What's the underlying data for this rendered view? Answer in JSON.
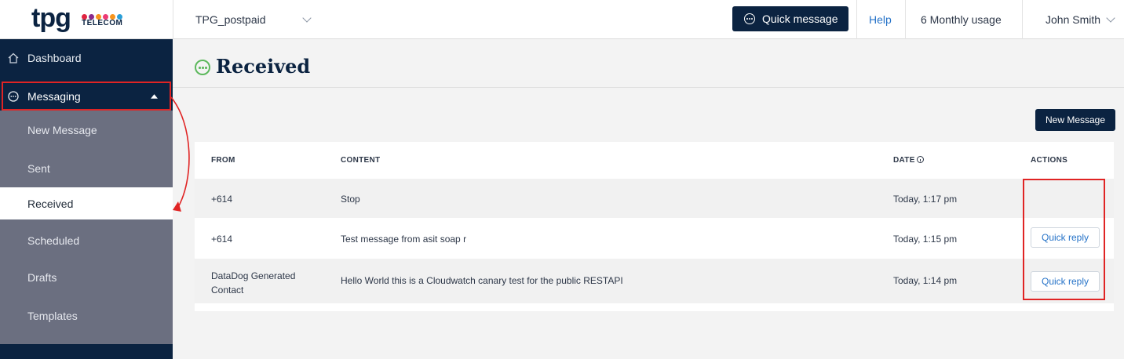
{
  "brand": {
    "logo_text": "tpg",
    "logo_subtext": "TELECOM",
    "dot_colors": [
      "#e02440",
      "#8b2a8c",
      "#f7941d",
      "#ee3a74",
      "#f7941d",
      "#2a9fd8"
    ]
  },
  "topbar": {
    "account": "TPG_postpaid",
    "quick_message": "Quick message",
    "help": "Help",
    "usage": "6 Monthly usage",
    "user": "John Smith"
  },
  "sidebar": {
    "dashboard": "Dashboard",
    "messaging": "Messaging",
    "submenu": [
      "New Message",
      "Sent",
      "Received",
      "Scheduled",
      "Drafts",
      "Templates"
    ]
  },
  "page": {
    "title": "Received",
    "new_message_button": "New Message"
  },
  "table": {
    "headers": {
      "from": "FROM",
      "content": "CONTENT",
      "date": "DATE",
      "actions": "ACTIONS"
    },
    "rows": [
      {
        "from": "+614",
        "content": "Stop",
        "date": "Today, 1:17 pm",
        "action": ""
      },
      {
        "from": "+614",
        "content": "Test message from asit soap r",
        "date": "Today, 1:15 pm",
        "action": "Quick reply"
      },
      {
        "from": "DataDog Generated Contact",
        "from_line1": "DataDog Generated",
        "from_line2": "Contact",
        "content": "Hello World this is a Cloudwatch canary test for the public RESTAPI",
        "date": "Today, 1:14 pm",
        "action": "Quick reply"
      }
    ]
  },
  "colors": {
    "navy": "#0b2341",
    "accent_green": "#5cb85c",
    "link_blue": "#2673c8",
    "annotation_red": "#e02424"
  }
}
